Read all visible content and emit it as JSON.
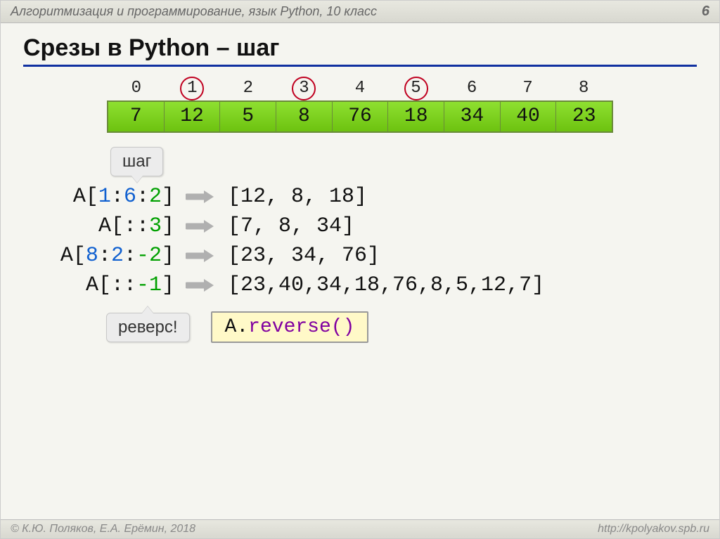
{
  "header": {
    "title": "Алгоритмизация и программирование, язык Python, 10 класс",
    "page": "6"
  },
  "title": "Срезы в Python – шаг",
  "array": {
    "indices": [
      "0",
      "1",
      "2",
      "3",
      "4",
      "5",
      "6",
      "7",
      "8"
    ],
    "circled": [
      1,
      3,
      5
    ],
    "values": [
      "7",
      "12",
      "5",
      "8",
      "76",
      "18",
      "34",
      "40",
      "23"
    ]
  },
  "callouts": {
    "step": "шаг",
    "reverse": "реверс!"
  },
  "examples": [
    {
      "lhs": {
        "pre": "A[",
        "a": "1",
        "b": "6",
        "c": "2",
        "post": "]"
      },
      "rhs": "[12, 8, 18]"
    },
    {
      "lhs": {
        "pre": "A[::",
        "a": "",
        "b": "",
        "c": "3",
        "post": "]"
      },
      "rhs": "[7, 8, 34]"
    },
    {
      "lhs": {
        "pre": "A[",
        "a": "8",
        "b": "2",
        "c": "-2",
        "post": "]"
      },
      "rhs": "[23, 34, 76]"
    },
    {
      "lhs": {
        "pre": "A[::",
        "a": "",
        "b": "",
        "c": "-1",
        "post": "]"
      },
      "rhs": "[23,40,34,18,76,8,5,12,7]"
    }
  ],
  "code_box": {
    "var": "A.",
    "method": "reverse()"
  },
  "footer": {
    "left": "© К.Ю. Поляков, Е.А. Ерёмин, 2018",
    "right": "http://kpolyakov.spb.ru"
  }
}
